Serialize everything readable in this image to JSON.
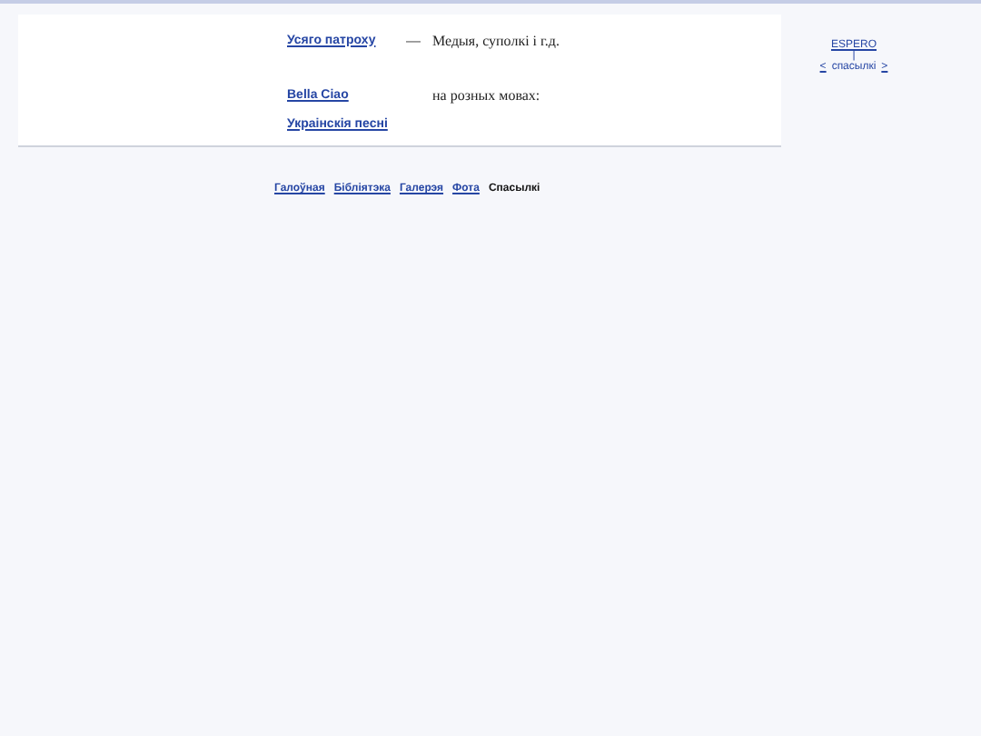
{
  "links": [
    {
      "title": "Усяго патроху",
      "separator": "—",
      "description": "Медыя, суполкі і г.д."
    },
    {
      "title": "Bella Ciao",
      "description": "на розных мовах:"
    },
    {
      "title": "Украінскія песні"
    }
  ],
  "side_nav": {
    "top": "ESPERO",
    "divider": "|",
    "prev": "<",
    "current": "спасылкі",
    "next": ">"
  },
  "footer_nav": [
    {
      "label": "Галоўная",
      "selected": false
    },
    {
      "label": "Бібліятэка",
      "selected": false
    },
    {
      "label": "Галерэя",
      "selected": false
    },
    {
      "label": "Фота",
      "selected": false
    },
    {
      "label": "Спасылкі",
      "selected": true
    }
  ]
}
